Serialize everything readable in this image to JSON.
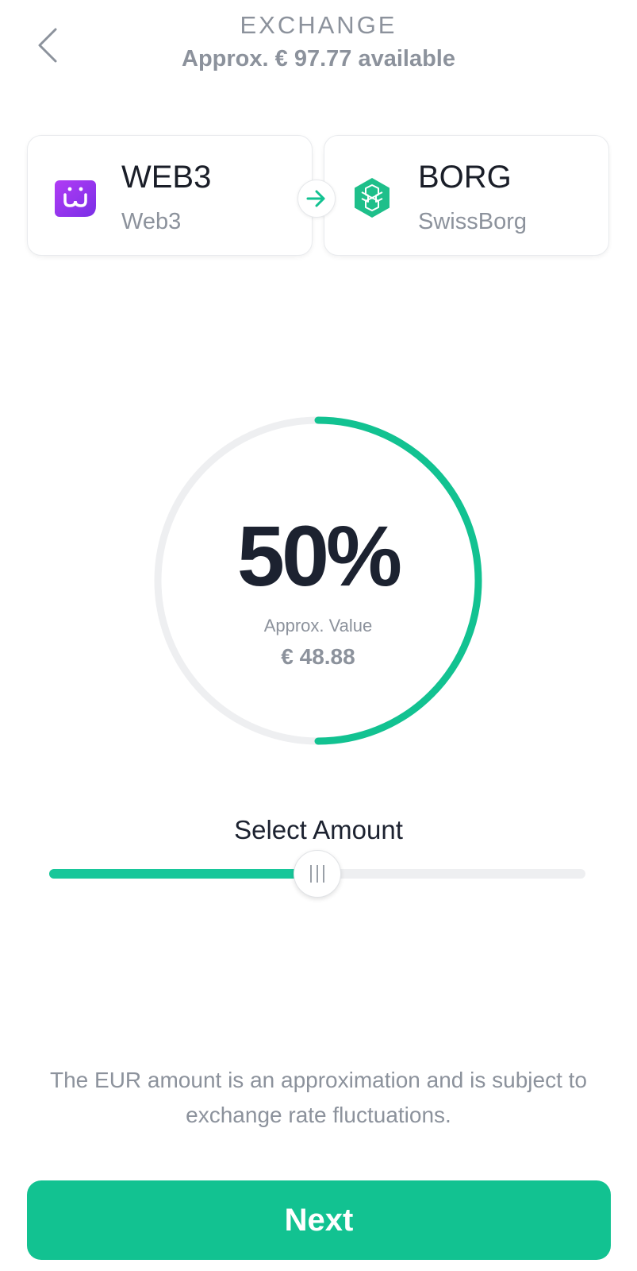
{
  "header": {
    "title": "EXCHANGE",
    "available": "Approx. € 97.77 available"
  },
  "from_asset": {
    "symbol": "WEB3",
    "name": "Web3",
    "icon": "web3-logo-icon",
    "color": "#8a2be2"
  },
  "to_asset": {
    "symbol": "BORG",
    "name": "SwissBorg",
    "icon": "swissborg-logo-icon",
    "color": "#1ebf8a"
  },
  "gauge": {
    "percent_label": "50%",
    "value_label": "Approx. Value",
    "value": "€ 48.88",
    "fraction": 0.5
  },
  "slider": {
    "label": "Select Amount",
    "fraction": 0.5
  },
  "disclaimer": "The EUR amount is an approximation and is subject to exchange rate fluctuations.",
  "next_button": {
    "label": "Next"
  },
  "colors": {
    "accent": "#12c291",
    "track": "#eeeff1",
    "muted_text": "#8c929c"
  }
}
